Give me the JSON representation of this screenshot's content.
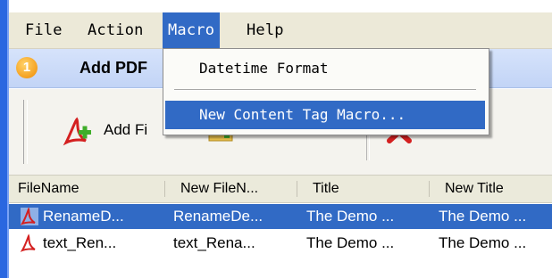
{
  "menubar": {
    "items": [
      {
        "label": "File",
        "active": false
      },
      {
        "label": "Action",
        "active": false
      },
      {
        "label": "Macro",
        "active": true
      },
      {
        "label": "Help",
        "active": false
      }
    ]
  },
  "step": {
    "number": "1",
    "title": "Add PDF"
  },
  "toolbar": {
    "add_files_label": "Add Fi",
    "add_folder_label": "Add Folder",
    "delete_label": "Delete"
  },
  "macro_menu": {
    "datetime_format": "Datetime Format",
    "new_content_tag_macro": "New Content Tag Macro..."
  },
  "table": {
    "headers": [
      "FileName",
      "New FileN...",
      "Title",
      "New Title"
    ],
    "rows": [
      {
        "cells": [
          "RenameD...",
          "RenameDe...",
          "The Demo ...",
          "The Demo ..."
        ],
        "selected": true
      },
      {
        "cells": [
          "text_Ren...",
          "text_Rena...",
          "The Demo ...",
          "The Demo ..."
        ],
        "selected": false
      }
    ]
  },
  "colors": {
    "selection": "#316ac5",
    "menubar": "#ece9d8",
    "step_header": "#c8d8f7",
    "pdf_red": "#d42020",
    "plus_green": "#3fae2a"
  }
}
